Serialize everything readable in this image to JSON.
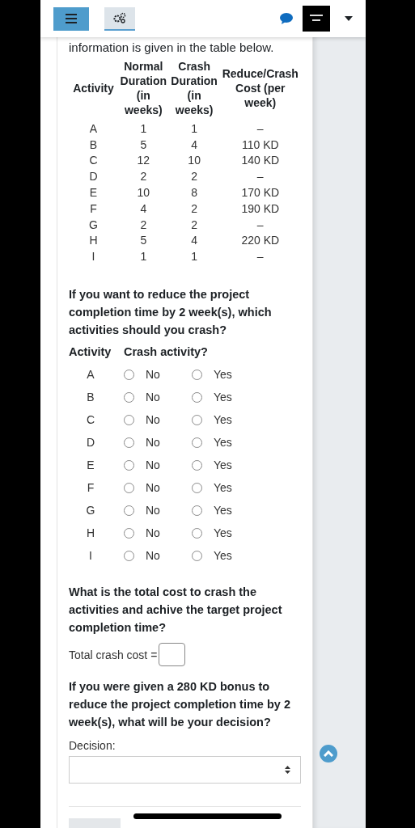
{
  "intro": "information is given in the table below.",
  "table": {
    "columns": [
      "Activity",
      "Normal Duration (in weeks)",
      "Crash Duration (in weeks)",
      "Reduce/Crash Cost (per week)"
    ],
    "rows": [
      [
        "A",
        "1",
        "1",
        "–"
      ],
      [
        "B",
        "5",
        "4",
        "110 KD"
      ],
      [
        "C",
        "12",
        "10",
        "140 KD"
      ],
      [
        "D",
        "2",
        "2",
        "–"
      ],
      [
        "E",
        "10",
        "8",
        "170 KD"
      ],
      [
        "F",
        "4",
        "2",
        "190 KD"
      ],
      [
        "G",
        "2",
        "2",
        "–"
      ],
      [
        "H",
        "5",
        "4",
        "220 KD"
      ],
      [
        "I",
        "1",
        "1",
        "–"
      ]
    ]
  },
  "question1": {
    "text": "If you want to reduce the project completion time by 2 week(s), which activities should you crash?",
    "columns": [
      "Activity",
      "Crash activity?"
    ],
    "rows": [
      {
        "activity": "A",
        "options": [
          {
            "label": "No",
            "selected": false
          },
          {
            "label": "Yes",
            "selected": false
          }
        ]
      },
      {
        "activity": "B",
        "options": [
          {
            "label": "No",
            "selected": false
          },
          {
            "label": "Yes",
            "selected": false
          }
        ]
      },
      {
        "activity": "C",
        "options": [
          {
            "label": "No",
            "selected": false
          },
          {
            "label": "Yes",
            "selected": false
          }
        ]
      },
      {
        "activity": "D",
        "options": [
          {
            "label": "No",
            "selected": false
          },
          {
            "label": "Yes",
            "selected": false
          }
        ]
      },
      {
        "activity": "E",
        "options": [
          {
            "label": "No",
            "selected": false
          },
          {
            "label": "Yes",
            "selected": false
          }
        ]
      },
      {
        "activity": "F",
        "options": [
          {
            "label": "No",
            "selected": false
          },
          {
            "label": "Yes",
            "selected": false
          }
        ]
      },
      {
        "activity": "G",
        "options": [
          {
            "label": "No",
            "selected": false
          },
          {
            "label": "Yes",
            "selected": false
          }
        ]
      },
      {
        "activity": "H",
        "options": [
          {
            "label": "No",
            "selected": false
          },
          {
            "label": "Yes",
            "selected": false
          }
        ]
      },
      {
        "activity": "I",
        "options": [
          {
            "label": "No",
            "selected": false
          },
          {
            "label": "Yes",
            "selected": false
          }
        ]
      }
    ]
  },
  "question2": {
    "text": "What is the total cost to crash the activities and achive the target project completion time?",
    "label": "Total crash cost ="
  },
  "question3": {
    "text": "If you were given a 280 KD bonus to reduce the project completion time by 2 week(s), what will be your decision?",
    "label": "Decision:"
  }
}
